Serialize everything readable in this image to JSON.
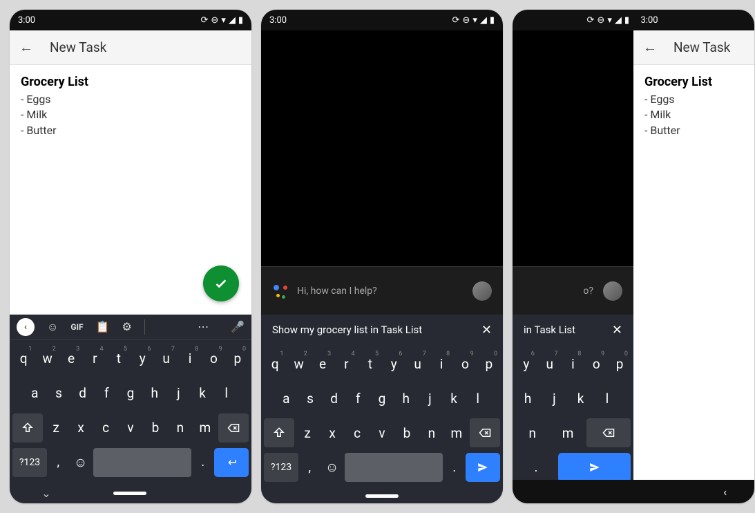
{
  "status": {
    "time": "3:00"
  },
  "app": {
    "title": "New Task",
    "note_title": "Grocery List",
    "items": [
      "- Eggs",
      "- Milk",
      "- Butter"
    ]
  },
  "assistant": {
    "prompt": "Hi, how can I help?",
    "query": "Show my grocery list in Task List",
    "query_partial": "in Task List"
  },
  "keyboard": {
    "row1_labels": [
      "q",
      "w",
      "e",
      "r",
      "t",
      "y",
      "u",
      "i",
      "o",
      "p"
    ],
    "row1_sup": [
      "1",
      "2",
      "3",
      "4",
      "5",
      "6",
      "7",
      "8",
      "9",
      "0"
    ],
    "row2_labels": [
      "a",
      "s",
      "d",
      "f",
      "g",
      "h",
      "j",
      "k",
      "l"
    ],
    "row3_labels": [
      "z",
      "x",
      "c",
      "v",
      "b",
      "n",
      "m"
    ],
    "sym_label": "?123",
    "comma": ",",
    "dot": ".",
    "gif": "GIF",
    "p3_row1_labels": [
      "y",
      "u",
      "i",
      "o",
      "p"
    ],
    "p3_row1_sup": [
      "6",
      "7",
      "8",
      "9",
      "0"
    ],
    "p3_row2_labels": [
      "h",
      "j",
      "k",
      "l"
    ],
    "p3_row3_labels": [
      "n",
      "m"
    ]
  }
}
